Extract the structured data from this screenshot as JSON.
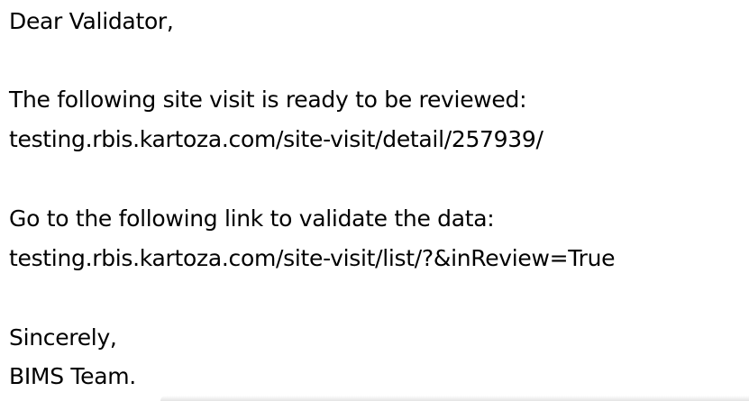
{
  "email": {
    "greeting": "Dear Validator,",
    "intro": "The following site visit is ready to be reviewed:",
    "detail_link": "testing.rbis.kartoza.com/site-visit/detail/257939/",
    "instruction": "Go to the following link to validate the data:",
    "review_link": "testing.rbis.kartoza.com/site-visit/list/?&inReview=True",
    "closing": "Sincerely,",
    "signature": "BIMS Team."
  }
}
